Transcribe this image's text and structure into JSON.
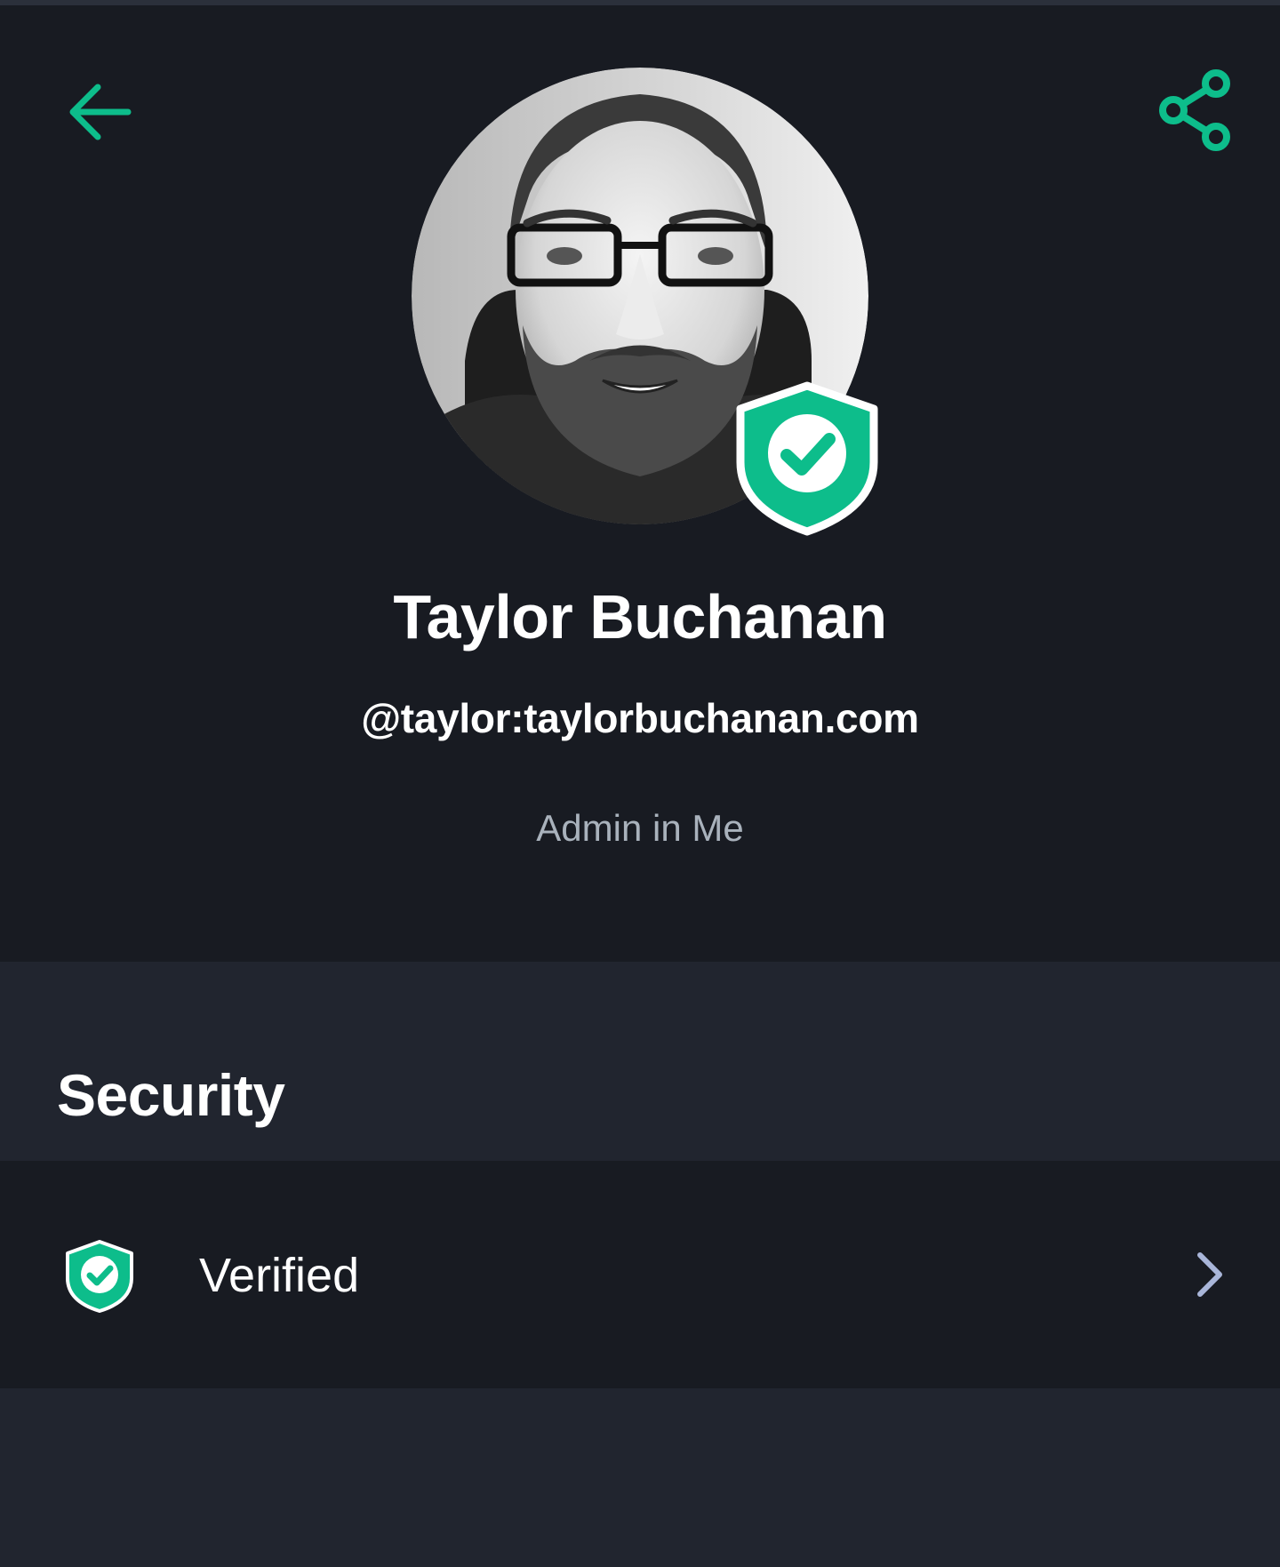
{
  "toolbar": {
    "back_icon": "arrow-left-icon",
    "share_icon": "share-icon",
    "accent_color": "#0dbd8b"
  },
  "profile": {
    "avatar_icon": "user-avatar",
    "badge_icon": "verified-shield-icon",
    "name": "Taylor Buchanan",
    "user_id": "@taylor:taylorbuchanan.com",
    "role": "Admin in Me"
  },
  "security": {
    "title": "Security",
    "row": {
      "icon": "verified-shield-icon",
      "label": "Verified",
      "chevron_icon": "chevron-right-icon"
    }
  },
  "colors": {
    "background_dark": "#181b22",
    "background_section": "#21252f",
    "text_primary": "#ffffff",
    "text_secondary": "#a9b2bc",
    "chevron": "#a9b6d9"
  }
}
